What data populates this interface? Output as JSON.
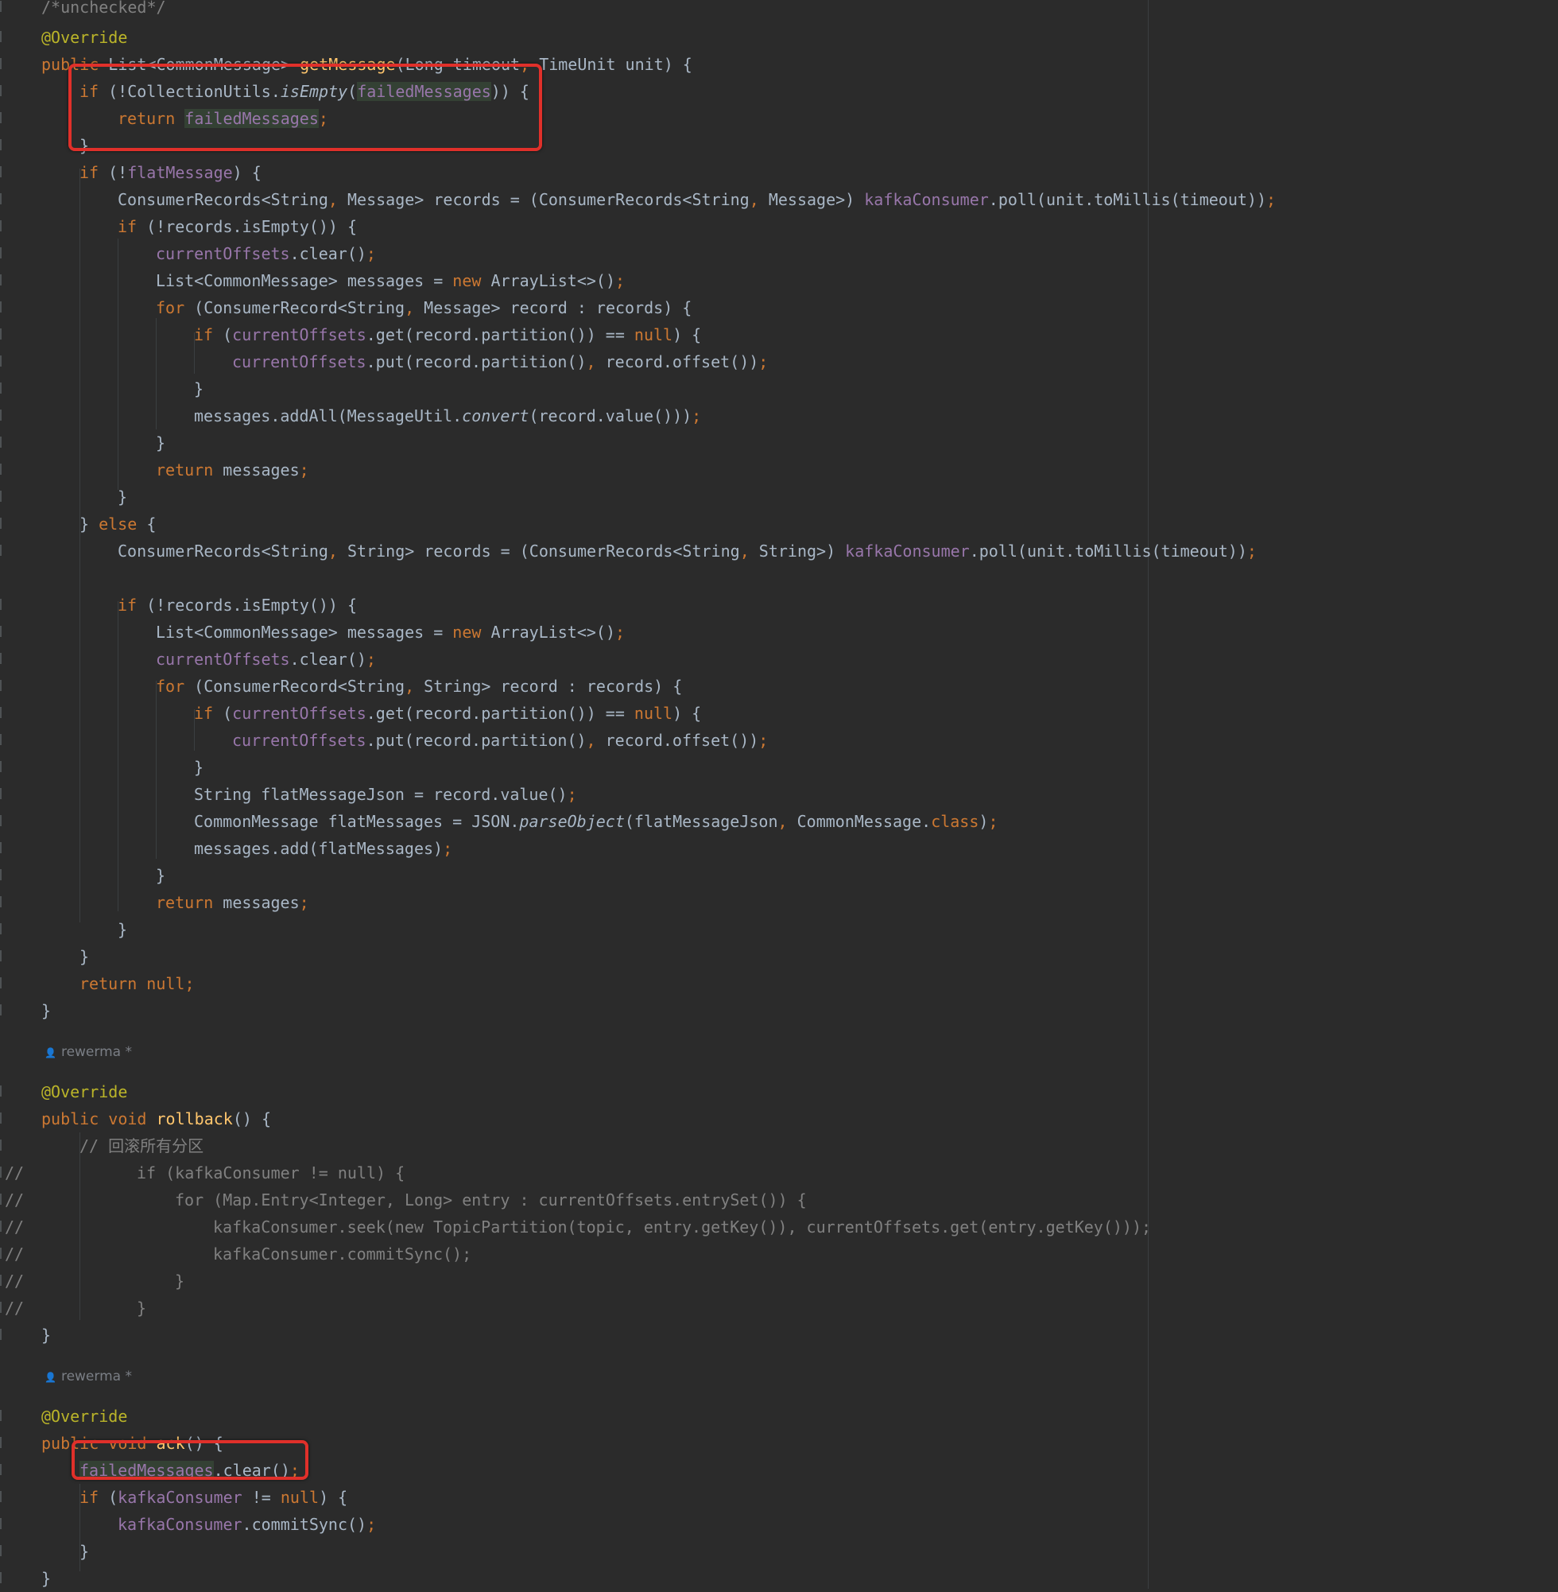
{
  "colors": {
    "background": "#2b2b2b",
    "keyword": "#cc7832",
    "annotation": "#bbb529",
    "method": "#ffc66d",
    "field": "#9876aa",
    "plain": "#a9b7c6",
    "comment": "#808080",
    "highlight_box": "#e0302a",
    "usage_highlight": "#344134"
  },
  "editor": {
    "author_hint_1": "rewerma *",
    "author_hint_2": "rewerma *",
    "author_icon": "person-icon",
    "lines": [
      [
        {
          "t": "/*unchecked*/",
          "c": "cmt"
        }
      ],
      [
        {
          "t": "@Override",
          "c": "ann"
        }
      ],
      [
        {
          "t": "public ",
          "c": "kw"
        },
        {
          "t": "List<CommonMessage> "
        },
        {
          "t": "getMessage",
          "c": "fn"
        },
        {
          "t": "(Long timeout"
        },
        {
          "t": ", ",
          "c": "kw"
        },
        {
          "t": "TimeUnit unit) {"
        }
      ],
      [
        {
          "t": "if ",
          "c": "kw"
        },
        {
          "t": "(!CollectionUtils."
        },
        {
          "t": "isEmpty",
          "c": "it"
        },
        {
          "t": "("
        },
        {
          "t": "failedMessages",
          "c": "fld hl"
        },
        {
          "t": ")) {"
        }
      ],
      [
        {
          "t": "return ",
          "c": "kw"
        },
        {
          "t": "failedMessages",
          "c": "fld hl"
        },
        {
          "t": ";",
          "c": "kw"
        }
      ],
      [
        {
          "t": "}"
        }
      ],
      [
        {
          "t": "if ",
          "c": "kw"
        },
        {
          "t": "(!"
        },
        {
          "t": "flatMessage",
          "c": "fld"
        },
        {
          "t": ") {"
        }
      ],
      [
        {
          "t": "ConsumerRecords<String"
        },
        {
          "t": ", ",
          "c": "kw"
        },
        {
          "t": "Message> records = (ConsumerRecords<String"
        },
        {
          "t": ", ",
          "c": "kw"
        },
        {
          "t": "Message>) "
        },
        {
          "t": "kafkaConsumer",
          "c": "fld"
        },
        {
          "t": ".poll(unit.toMillis(timeout))"
        },
        {
          "t": ";",
          "c": "kw"
        }
      ],
      [
        {
          "t": "if ",
          "c": "kw"
        },
        {
          "t": "(!records.isEmpty()) {"
        }
      ],
      [
        {
          "t": "currentOffsets",
          "c": "fld"
        },
        {
          "t": ".clear()"
        },
        {
          "t": ";",
          "c": "kw"
        }
      ],
      [
        {
          "t": "List<CommonMessage> messages = "
        },
        {
          "t": "new ",
          "c": "kw"
        },
        {
          "t": "ArrayList<>()"
        },
        {
          "t": ";",
          "c": "kw"
        }
      ],
      [
        {
          "t": "for ",
          "c": "kw"
        },
        {
          "t": "(ConsumerRecord<String"
        },
        {
          "t": ", ",
          "c": "kw"
        },
        {
          "t": "Message> record : records) {"
        }
      ],
      [
        {
          "t": "if ",
          "c": "kw"
        },
        {
          "t": "("
        },
        {
          "t": "currentOffsets",
          "c": "fld"
        },
        {
          "t": ".get(record.partition()) == "
        },
        {
          "t": "null",
          "c": "kw"
        },
        {
          "t": ") {"
        }
      ],
      [
        {
          "t": "currentOffsets",
          "c": "fld"
        },
        {
          "t": ".put(record.partition()"
        },
        {
          "t": ", ",
          "c": "kw"
        },
        {
          "t": "record.offset())"
        },
        {
          "t": ";",
          "c": "kw"
        }
      ],
      [
        {
          "t": "}"
        }
      ],
      [
        {
          "t": "messages.addAll(MessageUtil."
        },
        {
          "t": "convert",
          "c": "it"
        },
        {
          "t": "(record.value()))"
        },
        {
          "t": ";",
          "c": "kw"
        }
      ],
      [
        {
          "t": "}"
        }
      ],
      [
        {
          "t": "return ",
          "c": "kw"
        },
        {
          "t": "messages"
        },
        {
          "t": ";",
          "c": "kw"
        }
      ],
      [
        {
          "t": "}"
        }
      ],
      [
        {
          "t": "} "
        },
        {
          "t": "else ",
          "c": "kw"
        },
        {
          "t": "{"
        }
      ],
      [
        {
          "t": "ConsumerRecords<String"
        },
        {
          "t": ", ",
          "c": "kw"
        },
        {
          "t": "String> records = (ConsumerRecords<String"
        },
        {
          "t": ", ",
          "c": "kw"
        },
        {
          "t": "String>) "
        },
        {
          "t": "kafkaConsumer",
          "c": "fld"
        },
        {
          "t": ".poll(unit.toMillis(timeout))"
        },
        {
          "t": ";",
          "c": "kw"
        }
      ],
      [],
      [
        {
          "t": "if ",
          "c": "kw"
        },
        {
          "t": "(!records.isEmpty()) {"
        }
      ],
      [
        {
          "t": "List<CommonMessage> messages = "
        },
        {
          "t": "new ",
          "c": "kw"
        },
        {
          "t": "ArrayList<>()"
        },
        {
          "t": ";",
          "c": "kw"
        }
      ],
      [
        {
          "t": "currentOffsets",
          "c": "fld"
        },
        {
          "t": ".clear()"
        },
        {
          "t": ";",
          "c": "kw"
        }
      ],
      [
        {
          "t": "for ",
          "c": "kw"
        },
        {
          "t": "(ConsumerRecord<String"
        },
        {
          "t": ", ",
          "c": "kw"
        },
        {
          "t": "String> record : records) {"
        }
      ],
      [
        {
          "t": "if ",
          "c": "kw"
        },
        {
          "t": "("
        },
        {
          "t": "currentOffsets",
          "c": "fld"
        },
        {
          "t": ".get(record.partition()) == "
        },
        {
          "t": "null",
          "c": "kw"
        },
        {
          "t": ") {"
        }
      ],
      [
        {
          "t": "currentOffsets",
          "c": "fld"
        },
        {
          "t": ".put(record.partition()"
        },
        {
          "t": ", ",
          "c": "kw"
        },
        {
          "t": "record.offset())"
        },
        {
          "t": ";",
          "c": "kw"
        }
      ],
      [
        {
          "t": "}"
        }
      ],
      [
        {
          "t": "String flatMessageJson = record.value()"
        },
        {
          "t": ";",
          "c": "kw"
        }
      ],
      [
        {
          "t": "CommonMessage flatMessages = JSON."
        },
        {
          "t": "parseObject",
          "c": "it"
        },
        {
          "t": "(flatMessageJson"
        },
        {
          "t": ", ",
          "c": "kw"
        },
        {
          "t": "CommonMessage."
        },
        {
          "t": "class",
          "c": "kw"
        },
        {
          "t": ")"
        },
        {
          "t": ";",
          "c": "kw"
        }
      ],
      [
        {
          "t": "messages.add(flatMessages)"
        },
        {
          "t": ";",
          "c": "kw"
        }
      ],
      [
        {
          "t": "}"
        }
      ],
      [
        {
          "t": "return ",
          "c": "kw"
        },
        {
          "t": "messages"
        },
        {
          "t": ";",
          "c": "kw"
        }
      ],
      [
        {
          "t": "}"
        }
      ],
      [
        {
          "t": "}"
        }
      ],
      [
        {
          "t": "return null;",
          "c": "kw"
        }
      ],
      [
        {
          "t": "}"
        }
      ],
      [],
      [],
      [
        {
          "t": "@Override",
          "c": "ann"
        }
      ],
      [
        {
          "t": "public void ",
          "c": "kw"
        },
        {
          "t": "rollback",
          "c": "fn"
        },
        {
          "t": "() {"
        }
      ],
      [
        {
          "t": "// 回滚所有分区",
          "c": "cmt"
        }
      ],
      [
        {
          "t": "if (kafkaConsumer != null) {",
          "c": "cmt"
        }
      ],
      [
        {
          "t": "for (Map.Entry<Integer, Long> entry : currentOffsets.entrySet()) {",
          "c": "cmt"
        }
      ],
      [
        {
          "t": "kafkaConsumer.seek(new TopicPartition(topic, entry.getKey()), currentOffsets.get(entry.getKey()));",
          "c": "cmt"
        }
      ],
      [
        {
          "t": "kafkaConsumer.commitSync();",
          "c": "cmt"
        }
      ],
      [
        {
          "t": "}",
          "c": "cmt"
        }
      ],
      [
        {
          "t": "}",
          "c": "cmt"
        }
      ],
      [
        {
          "t": "}"
        }
      ],
      [],
      [],
      [
        {
          "t": "@Override",
          "c": "ann"
        }
      ],
      [
        {
          "t": "public void ",
          "c": "kw"
        },
        {
          "t": "ack",
          "c": "fn"
        },
        {
          "t": "() {"
        }
      ],
      [
        {
          "t": "failedMessages",
          "c": "fld hl"
        },
        {
          "t": ".clear()"
        },
        {
          "t": ";",
          "c": "kw"
        }
      ],
      [
        {
          "t": "if ",
          "c": "kw"
        },
        {
          "t": "("
        },
        {
          "t": "kafkaConsumer",
          "c": "fld"
        },
        {
          "t": " != "
        },
        {
          "t": "null",
          "c": "kw"
        },
        {
          "t": ") {"
        }
      ],
      [
        {
          "t": "kafkaConsumer",
          "c": "fld"
        },
        {
          "t": ".commitSync()"
        },
        {
          "t": ";",
          "c": "kw"
        }
      ],
      [
        {
          "t": "}"
        }
      ],
      [
        {
          "t": "}"
        }
      ]
    ],
    "comment_markers": [
      "//",
      "//",
      "//",
      "//",
      "//",
      "//"
    ]
  }
}
